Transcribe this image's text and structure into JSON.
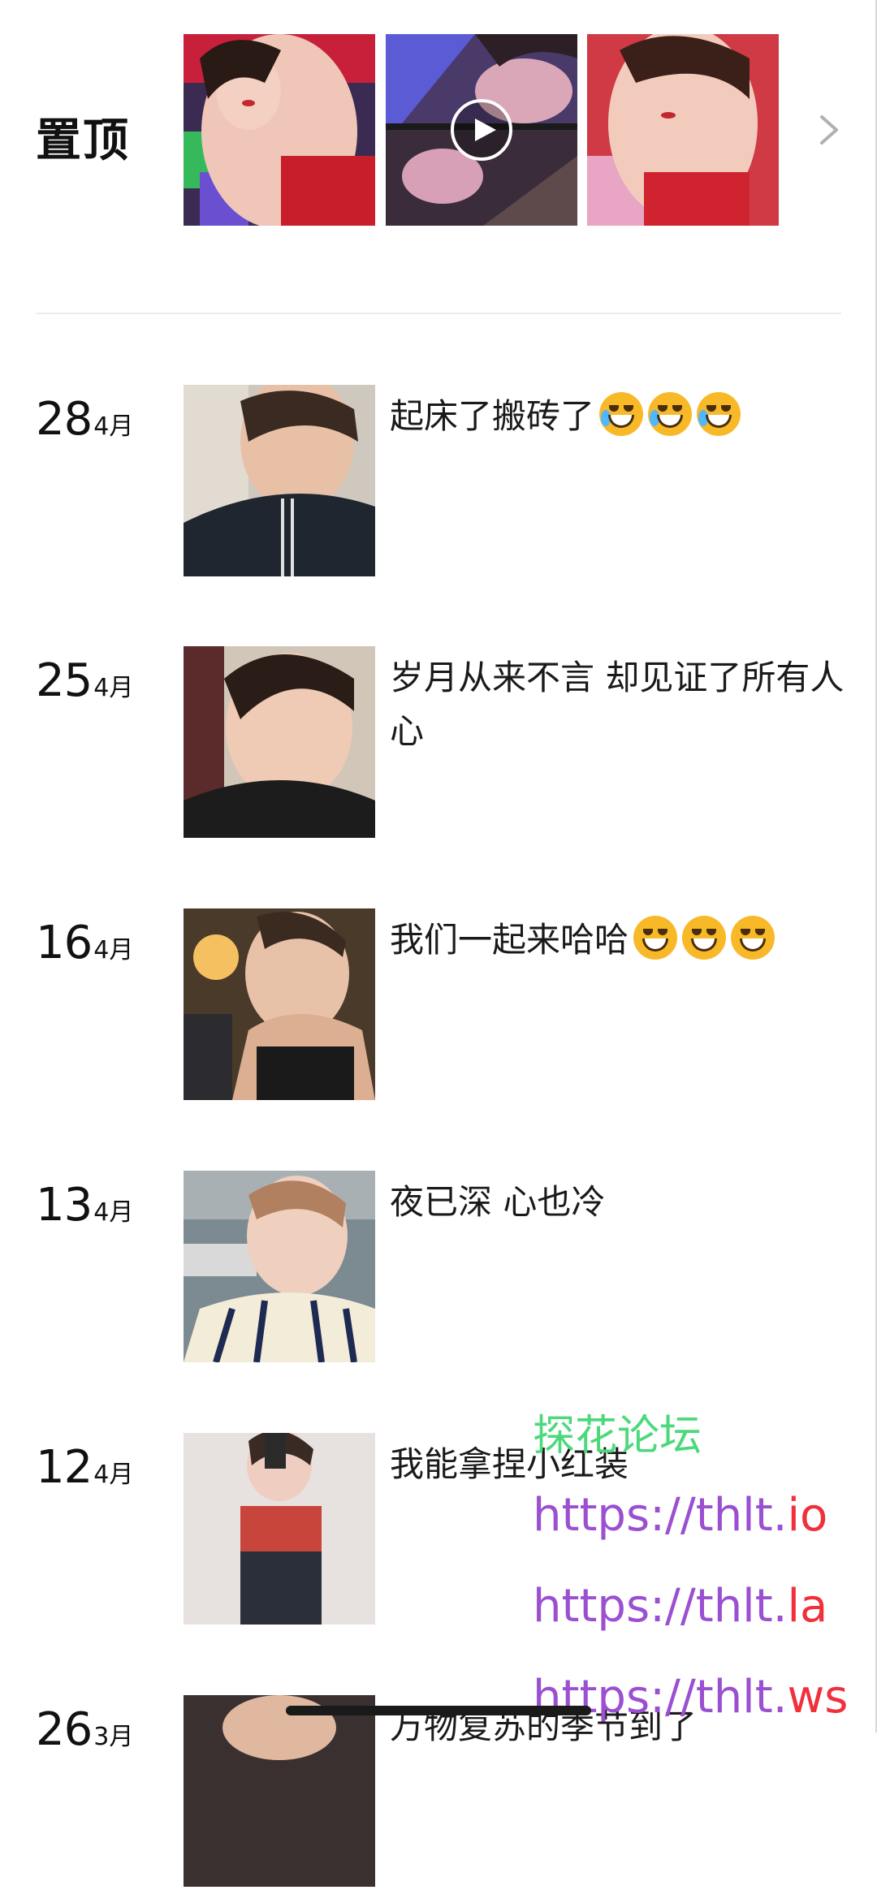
{
  "pinned": {
    "label": "置顶"
  },
  "posts": [
    {
      "day": "28",
      "month": "4月",
      "caption": "起床了搬砖了",
      "emoji": "laughing-crying-emoji",
      "emoji_count": 3
    },
    {
      "day": "25",
      "month": "4月",
      "caption": "岁月从来不言 却见证了所有人心"
    },
    {
      "day": "16",
      "month": "4月",
      "caption": "我们一起来哈哈",
      "emoji": "grinning-emoji",
      "emoji_count": 3
    },
    {
      "day": "13",
      "month": "4月",
      "caption": "夜已深 心也冷"
    },
    {
      "day": "12",
      "month": "4月",
      "caption": "我能拿捏小红装"
    },
    {
      "day": "26",
      "month": "3月",
      "caption": "万物复苏的季节到了"
    }
  ],
  "watermark": {
    "forum": "探花论坛",
    "link_prefix": "https://thlt.",
    "tld1": "io",
    "tld2": "la",
    "tld3": "ws"
  },
  "colors": {
    "watermark_green": "#4cd97b",
    "watermark_purple": "#9b4fd1",
    "watermark_red": "#f0303b"
  }
}
